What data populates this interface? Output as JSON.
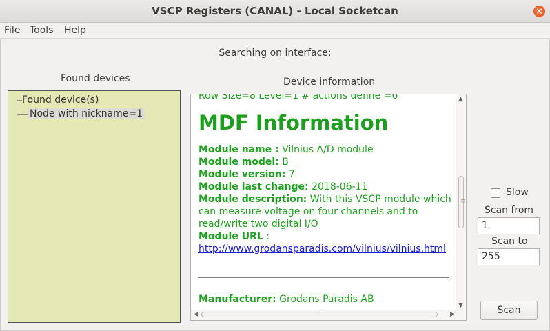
{
  "window": {
    "title": "VSCP Registers (CANAL) - Local Socketcan",
    "close_glyph": "×"
  },
  "menu": {
    "file": "File",
    "tools": "Tools",
    "help": "Help"
  },
  "status": {
    "text": "Searching on interface:"
  },
  "found_devices": {
    "header": "Found devices",
    "tree": {
      "root": "Found device(s)",
      "child": "Node with nickname=1"
    },
    "background_color": "#e3e8b4"
  },
  "device_information": {
    "header": "Device information",
    "cut_line": "Row Size=8 Level=1 # actions define =6",
    "mdf_title": "MDF Information",
    "fields": [
      {
        "label": "Module name :",
        "value": " Vilnius A/D module"
      },
      {
        "label": "Module model:",
        "value": " B"
      },
      {
        "label": "Module version:",
        "value": " 7"
      },
      {
        "label": "Module last change:",
        "value": " 2018-06-11"
      },
      {
        "label": "Module description:",
        "value": " With this VSCP module which can measure voltage on four channels and to read/write two digital I/O"
      },
      {
        "label": "Module URL",
        "value": " :"
      }
    ],
    "module_url": "http://www.grodansparadis.com/vilnius/vilnius.html",
    "manufacturer_label": "Manufacturer:",
    "manufacturer_value": " Grodans Paradis AB",
    "text_color": "#1fa21f",
    "link_color": "#1b1bd6"
  },
  "scan_options": {
    "slow_label": "Slow",
    "slow_checked": false,
    "scan_from_label": "Scan from",
    "scan_from_value": "1",
    "scan_to_label": "Scan to",
    "scan_to_value": "255",
    "scan_button": "Scan"
  }
}
